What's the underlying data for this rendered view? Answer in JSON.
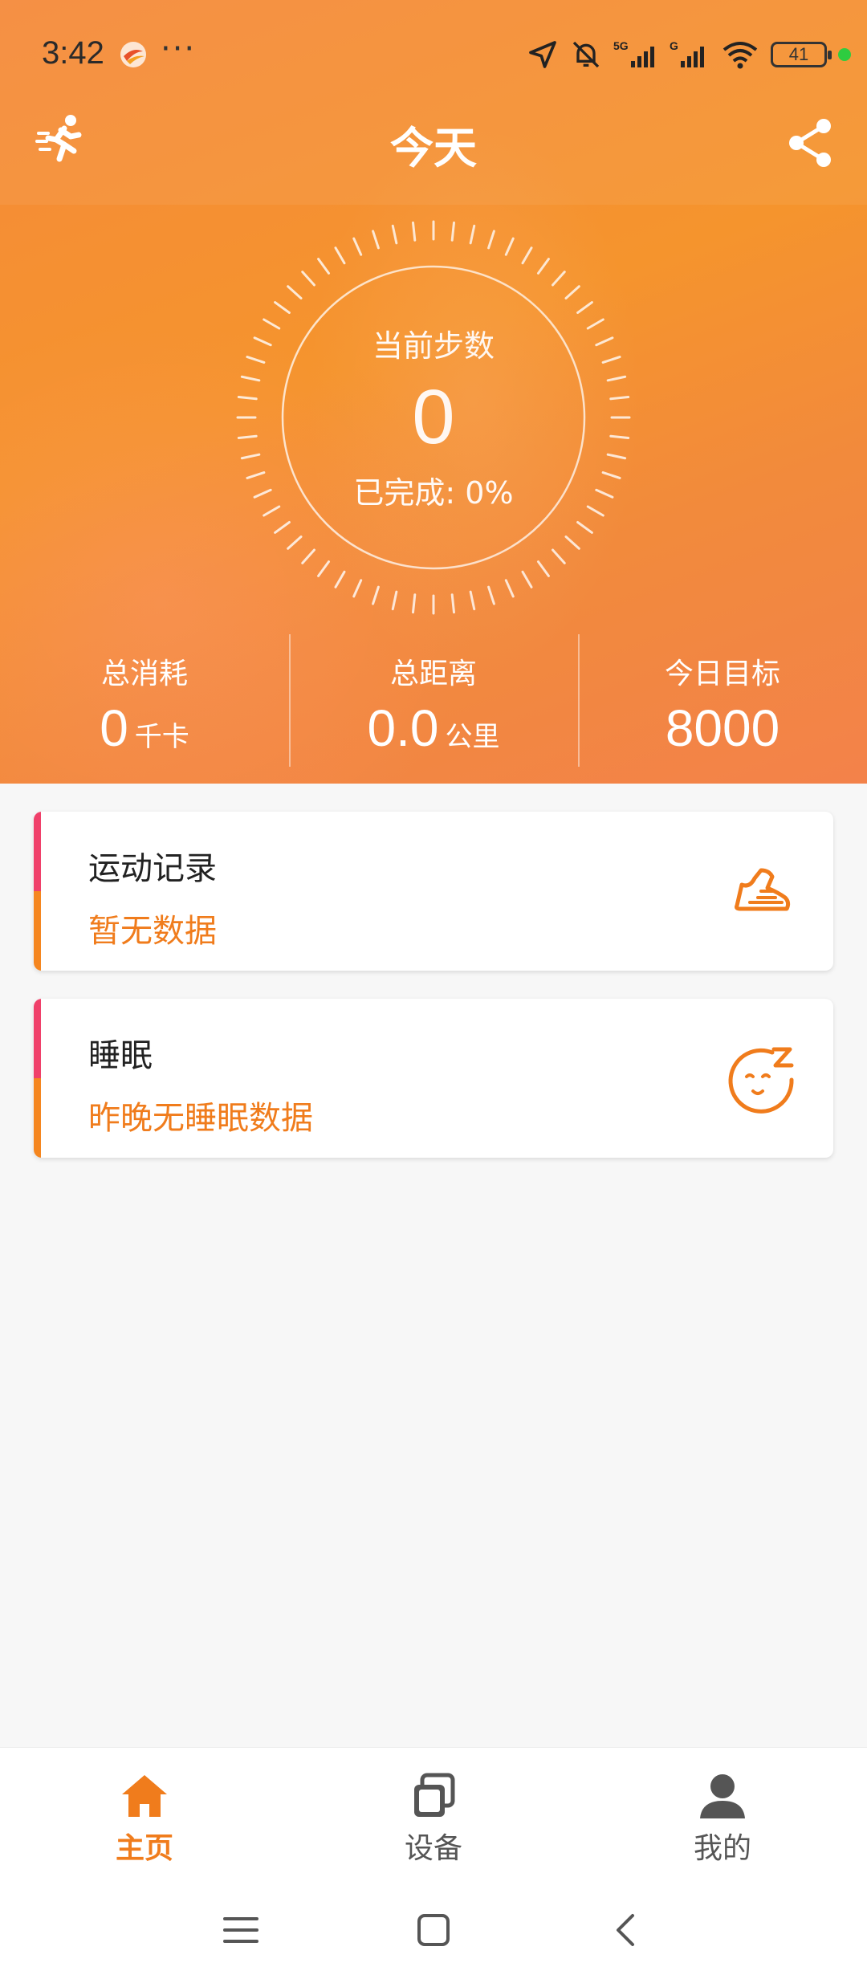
{
  "status_bar": {
    "time": "3:42",
    "more": "···",
    "battery": "41",
    "icons": [
      "location-icon",
      "mute-bell-icon",
      "signal-5g-icon",
      "signal-g-icon",
      "wifi-icon",
      "battery-icon"
    ]
  },
  "header": {
    "title": "今天"
  },
  "steps": {
    "label": "当前步数",
    "value": "0",
    "progress_label": "已完成: 0%",
    "progress_fraction": 0
  },
  "stats": [
    {
      "label": "总消耗",
      "value": "0",
      "unit": "千卡"
    },
    {
      "label": "总距离",
      "value": "0.0",
      "unit": "公里"
    },
    {
      "label": "今日目标",
      "value": "8000",
      "unit": ""
    }
  ],
  "cards": [
    {
      "title": "运动记录",
      "subtitle": "暂无数据",
      "icon": "sneaker-icon"
    },
    {
      "title": "睡眠",
      "subtitle": "昨晚无睡眠数据",
      "icon": "sleep-face-icon"
    }
  ],
  "tabs": [
    {
      "label": "主页",
      "icon": "home-icon",
      "active": true
    },
    {
      "label": "设备",
      "icon": "devices-icon",
      "active": false
    },
    {
      "label": "我的",
      "icon": "profile-icon",
      "active": false
    }
  ],
  "colors": {
    "accent": "#f07c1c",
    "hero_start": "#f58a3a",
    "hero_end": "#f3824a",
    "card_bar_top": "#f0406a",
    "card_bar_bottom": "#f5861f"
  }
}
